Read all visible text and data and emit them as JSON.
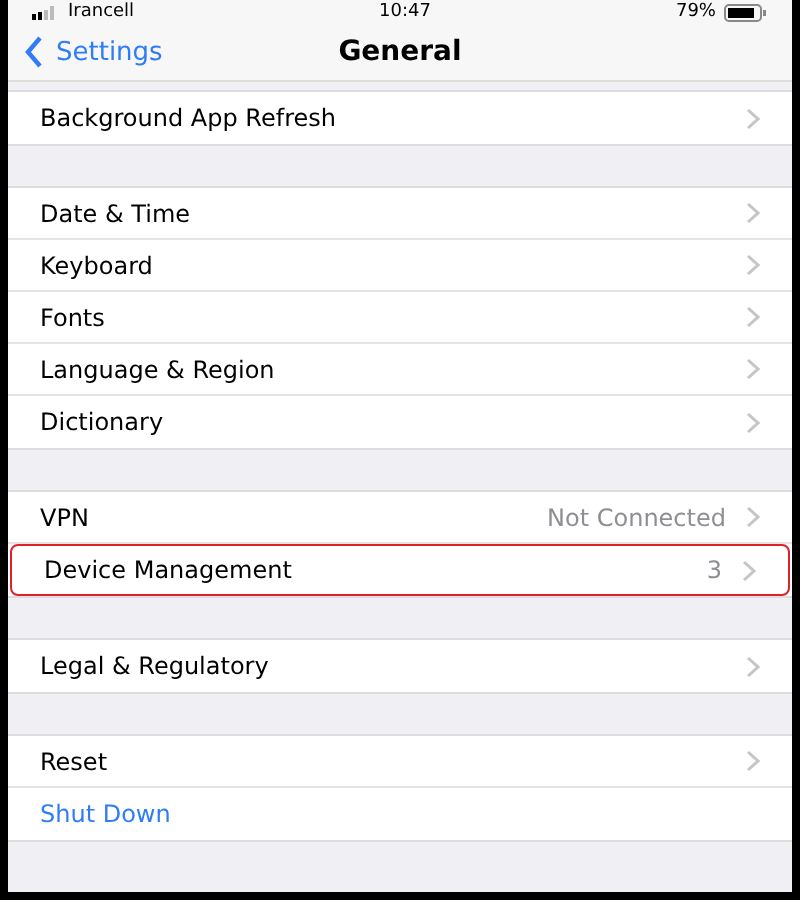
{
  "status_bar": {
    "carrier": "Irancell",
    "time": "10:47",
    "battery": "79%"
  },
  "nav": {
    "back": "Settings",
    "title": "General"
  },
  "groups": [
    {
      "rows": [
        {
          "label": "Background App Refresh",
          "highlighted": false
        }
      ]
    },
    {
      "rows": [
        {
          "label": "Date & Time",
          "highlighted": false
        },
        {
          "label": "Keyboard",
          "highlighted": false
        },
        {
          "label": "Fonts",
          "highlighted": false
        },
        {
          "label": "Language & Region",
          "highlighted": false
        },
        {
          "label": "Dictionary",
          "highlighted": false
        }
      ]
    },
    {
      "rows": [
        {
          "label": "VPN",
          "value": "Not Connected",
          "highlighted": false
        },
        {
          "label": "Device Management",
          "value": "3",
          "highlighted": true
        }
      ]
    },
    {
      "rows": [
        {
          "label": "Legal & Regulatory",
          "highlighted": false
        }
      ]
    },
    {
      "rows": [
        {
          "label": "Reset",
          "highlighted": false
        },
        {
          "label": "Shut Down",
          "kind": "action",
          "highlighted": false
        }
      ]
    }
  ]
}
